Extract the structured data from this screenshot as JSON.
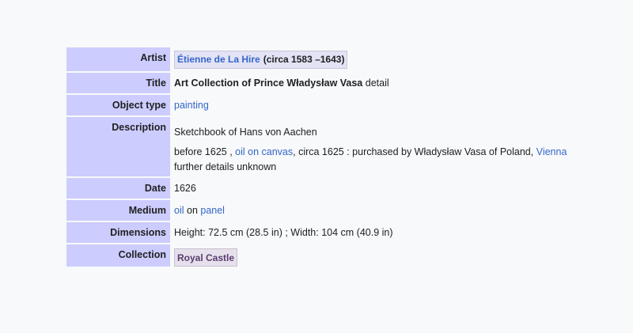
{
  "rows": {
    "artist": {
      "label": "Artist",
      "name": "Étienne de La Hire",
      "dates": "(circa 1583 –1643)"
    },
    "title": {
      "label": "Title",
      "name": "Art Collection of Prince Władysław Vasa",
      "suffix": "detail"
    },
    "object_type": {
      "label": "Object type",
      "value": "painting"
    },
    "description": {
      "label": "Description",
      "line1": "Sketchbook of Hans von Aachen",
      "part1": "before 1625 , ",
      "link1": "oil on canvas",
      "part2": ", circa 1625 : purchased by Władysław Vasa of Poland, ",
      "link2": "Vienna",
      "part3": "further details unknown"
    },
    "date": {
      "label": "Date",
      "value": "1626"
    },
    "medium": {
      "label": "Medium",
      "link1": "oil",
      "middle": " on ",
      "link2": "panel"
    },
    "dimensions": {
      "label": "Dimensions",
      "value": "Height: 72.5 cm (28.5 in) ; Width: 104 cm (40.9 in)"
    },
    "collection": {
      "label": "Collection",
      "value": "Royal Castle"
    }
  }
}
